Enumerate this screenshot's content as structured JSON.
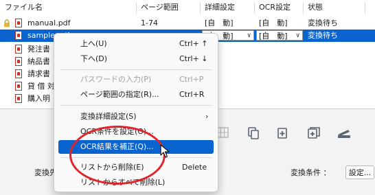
{
  "columns": [
    "ファイル名",
    "ページ範囲",
    "詳細設定",
    "OCR設定",
    "状態"
  ],
  "rows": [
    {
      "name": "manual.pdf",
      "pages": "1-74",
      "detail": "[自　動]",
      "ocr": "[自　動]",
      "status": "変換待ち"
    },
    {
      "name": "sample.pdf",
      "pages": "",
      "detail": "[自　動]",
      "ocr": "[自　動]",
      "status": "変換待ち"
    },
    {
      "name": "発注書",
      "pages": "",
      "detail": "",
      "ocr": "",
      "status": ""
    },
    {
      "name": "納品書",
      "pages": "",
      "detail": "",
      "ocr": "",
      "status": ""
    },
    {
      "name": "請求書",
      "pages": "",
      "detail": "",
      "ocr": "",
      "status": ""
    },
    {
      "name": "貸 借 対",
      "pages": "",
      "detail": "",
      "ocr": "",
      "status": ""
    },
    {
      "name": "購入明",
      "pages": "",
      "detail": "",
      "ocr": "",
      "status": ""
    }
  ],
  "menu": {
    "items": [
      {
        "label": "上へ(U)",
        "shortcut": "Ctrl+ ↑"
      },
      {
        "label": "下へ(D)",
        "shortcut": "Ctrl+ ↓"
      },
      {
        "label": "パスワードの入力(P)",
        "shortcut": "Ctrl+P"
      },
      {
        "label": "ページ範囲の指定(R)...",
        "shortcut": "Ctrl+R"
      },
      {
        "label": "変換詳細設定(S)",
        "shortcut": "›"
      },
      {
        "label": "OCR条件を設定(O)...",
        "shortcut": ""
      },
      {
        "label": "OCR結果を補正(Q)...",
        "shortcut": ""
      },
      {
        "label": "リストから削除(E)",
        "shortcut": "Delete"
      },
      {
        "label": "リストからすべて削除(L)",
        "shortcut": ""
      }
    ]
  },
  "lower": {
    "convert_label": "変換先",
    "condition_label": "変換条件 ：",
    "settings_button": "設定..."
  },
  "colors": {
    "selection": "#0a64d0",
    "annotation": "#e0242a"
  },
  "icons": [
    "lock-icon",
    "pdf-icon",
    "grid-icon",
    "copy-icon",
    "add-page-icon",
    "add-file-icon",
    "scanner-icon",
    "mouse-cursor-icon"
  ]
}
